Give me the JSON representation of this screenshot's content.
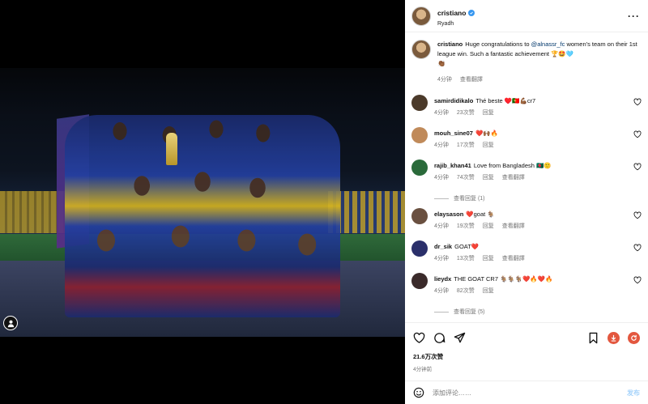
{
  "post": {
    "username": "cristiano",
    "location": "Ryadh",
    "caption_user": "cristiano",
    "caption_text_pre": "Huge congratulations to ",
    "caption_mention": "@alnassr_fc",
    "caption_text_post": " women's team on their 1st league win. Such a fantastic achievement 🏆🤩🩵",
    "caption_emoji_line": "👏🏾",
    "caption_time": "4分钟",
    "caption_translate": "查看翻譯"
  },
  "comments": [
    {
      "user": "samirdidikalo",
      "text": "Thé beste ♥️🇵🇹💪🏾cr7",
      "time": "4分钟",
      "likes": "23次赞",
      "reply": "回复",
      "translate": "",
      "avatar_color": "#4b3a2a"
    },
    {
      "user": "mouh_sine07",
      "text": "❤️🙌🏾🔥",
      "time": "4分钟",
      "likes": "17次赞",
      "reply": "回复",
      "translate": "",
      "avatar_color": "#c08a5a"
    },
    {
      "user": "rajib_khan41",
      "text": "Love from Bangladesh 🇧🇩🙂",
      "time": "4分钟",
      "likes": "74次赞",
      "reply": "回复",
      "translate": "查看翻譯",
      "avatar_color": "#2a6a3a"
    },
    {
      "user": "elaysason",
      "text": "❤️goat 🐐",
      "time": "4分钟",
      "likes": "19次赞",
      "reply": "回复",
      "translate": "查看翻譯",
      "avatar_color": "#6a5040"
    },
    {
      "user": "dr_sik",
      "text": "GOAT❤️",
      "time": "4分钟",
      "likes": "13次赞",
      "reply": "回复",
      "translate": "查看翻譯",
      "avatar_color": "#2a2f6a"
    },
    {
      "user": "lieydx",
      "text": "THE GOAT CR7 🐐🐐🐐❤️🔥❤️🔥",
      "time": "4分钟",
      "likes": "82次赞",
      "reply": "回复",
      "translate": "",
      "avatar_color": "#3a2a2a"
    }
  ],
  "view_replies": [
    "查看回复 (1)",
    "查看回复 (5)"
  ],
  "engagement": {
    "likes": "21.6万次赞",
    "time": "4分钟前"
  },
  "add_comment": {
    "placeholder": "添加评论……",
    "post_label": "发布"
  },
  "colors": {
    "link": "#00376b",
    "muted": "#737373",
    "verified": "#3797f0",
    "accent_red": "#e3573f"
  }
}
